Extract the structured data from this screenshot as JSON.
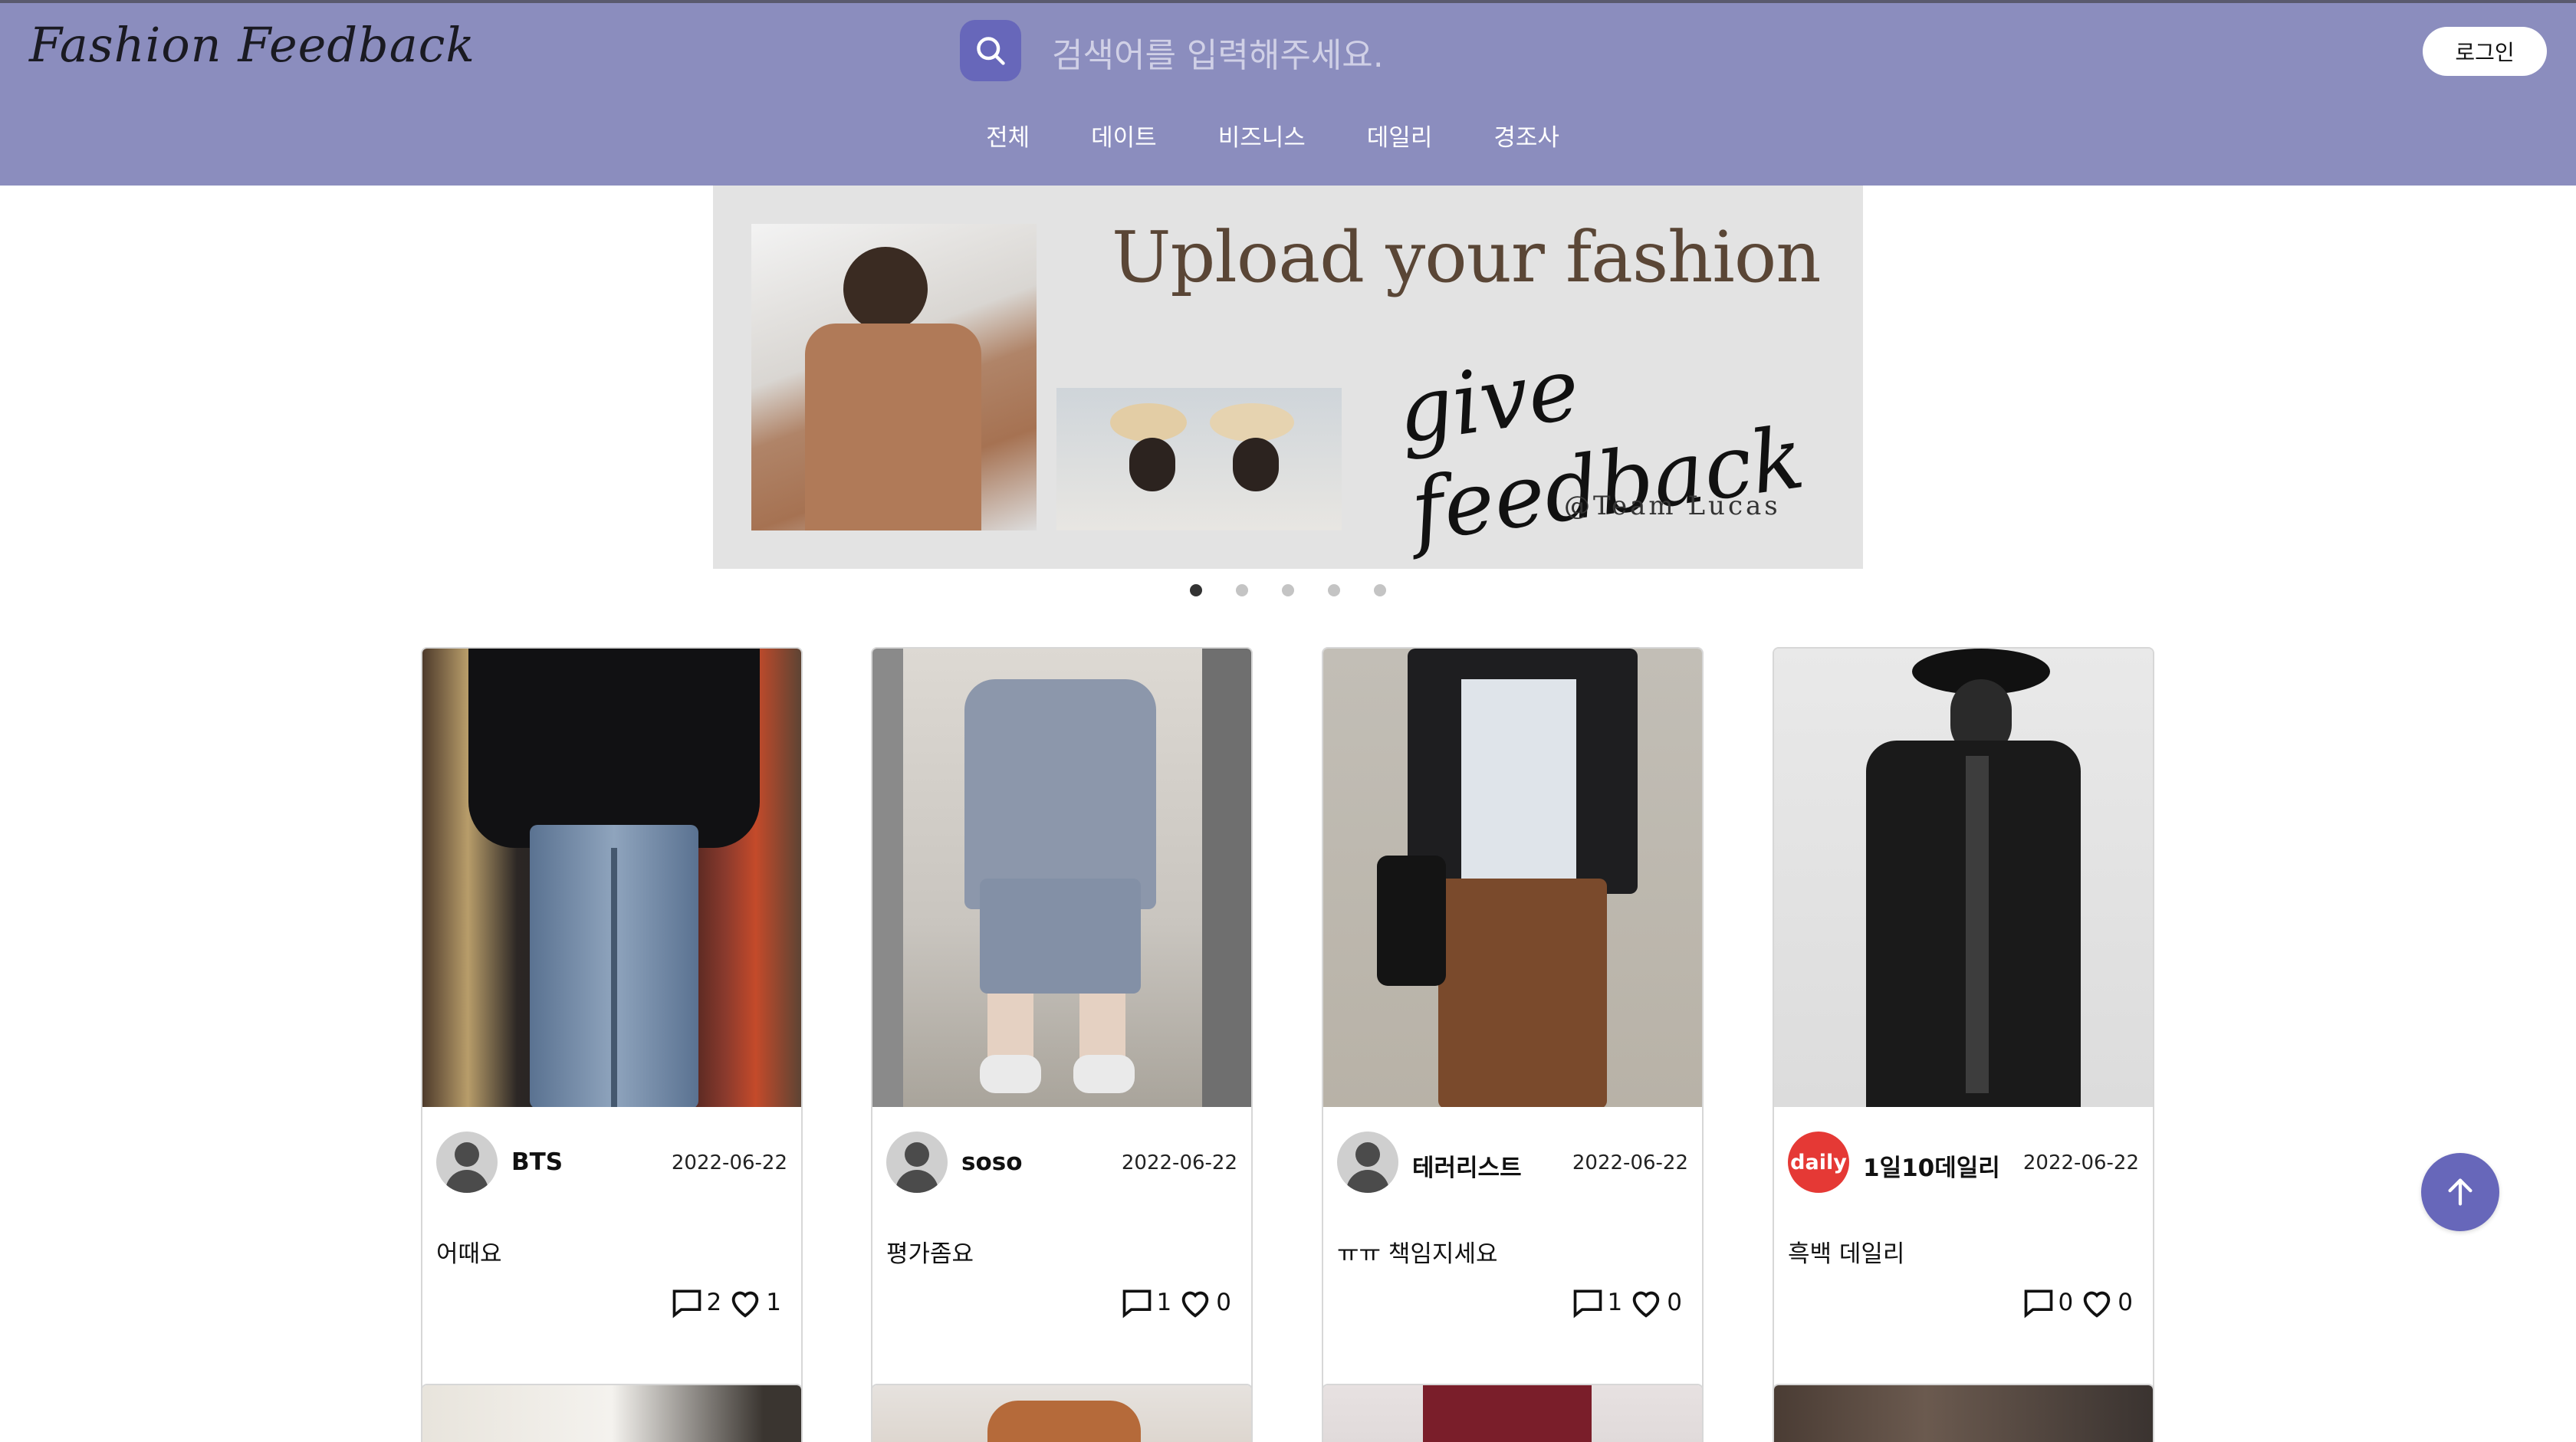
{
  "header": {
    "logo": "Fashion Feedback",
    "search": {
      "placeholder": "검색어를 입력해주세요."
    },
    "login_label": "로그인",
    "nav": [
      "전체",
      "데이트",
      "비즈니스",
      "데일리",
      "경조사"
    ]
  },
  "banner": {
    "title": "Upload your fashion",
    "script": "give feedback",
    "signature": "@Team Lucas",
    "slide_count": 5,
    "active_slide": 1
  },
  "posts": [
    {
      "username": "BTS",
      "date": "2022-06-22",
      "title": "어때요",
      "comments": "2",
      "likes": "1",
      "avatar": "default-avatar"
    },
    {
      "username": "soso",
      "date": "2022-06-22",
      "title": "평가좀요",
      "comments": "1",
      "likes": "0",
      "avatar": "default-avatar"
    },
    {
      "username": "테러리스트",
      "date": "2022-06-22",
      "title": "ㅠㅠ 책임지세요",
      "comments": "1",
      "likes": "0",
      "avatar": "default-avatar"
    },
    {
      "username": "1일10데일리",
      "date": "2022-06-22",
      "title": "흑백 데일리",
      "comments": "0",
      "likes": "0",
      "avatar": "daily",
      "avatar_text": "daily"
    }
  ],
  "colors": {
    "header_bg": "#8b8dbe",
    "accent": "#6767ba",
    "daily_avatar": "#e53935"
  }
}
